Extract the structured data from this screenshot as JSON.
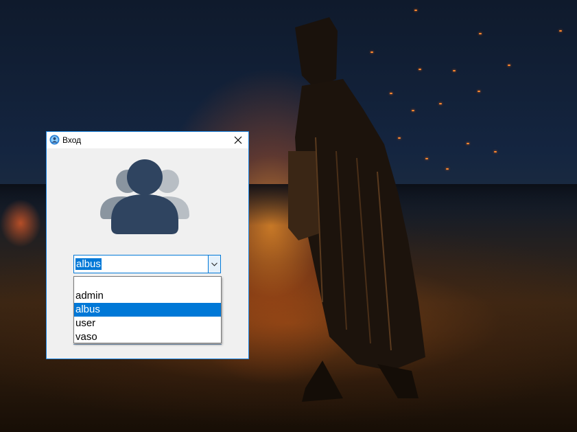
{
  "window": {
    "title": "Вход"
  },
  "login": {
    "selected_user": "albus"
  },
  "dropdown": {
    "items": [
      {
        "label": ""
      },
      {
        "label": "admin"
      },
      {
        "label": "albus"
      },
      {
        "label": "user"
      },
      {
        "label": "vaso"
      }
    ],
    "selected_index": 2
  },
  "colors": {
    "accent": "#0078d7",
    "avatar_front": "#2f4460",
    "avatar_back": "#8a95a0",
    "avatar_back_right": "#b8bec4",
    "window_bg": "#f0f0f0"
  },
  "icons": {
    "app": "user-globe-icon",
    "close": "close-icon",
    "dropdown_arrow": "chevron-down-icon",
    "avatar": "users-group-icon"
  }
}
